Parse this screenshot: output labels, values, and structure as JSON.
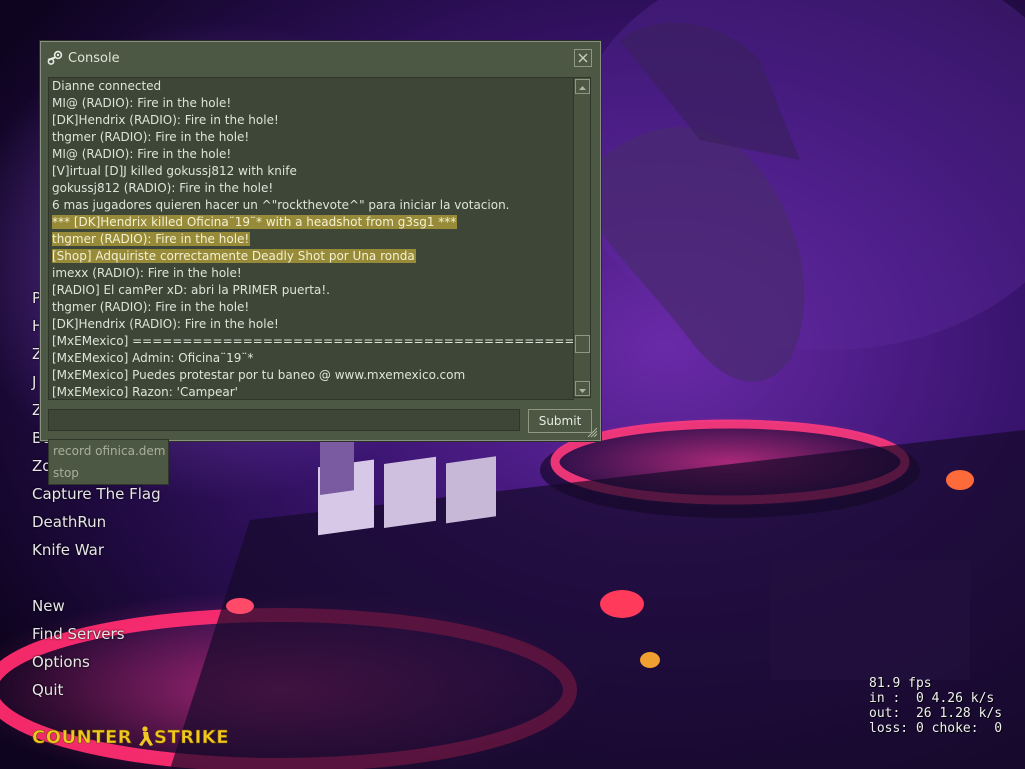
{
  "console": {
    "title": "Console",
    "lines": [
      {
        "text": "Dianne connected",
        "highlight": false
      },
      {
        "text": "MI@ (RADIO): Fire in the hole!",
        "highlight": false
      },
      {
        "text": "[DK]Hendrix (RADIO): Fire in the hole!",
        "highlight": false
      },
      {
        "text": "thgmer (RADIO): Fire in the hole!",
        "highlight": false
      },
      {
        "text": "MI@ (RADIO): Fire in the hole!",
        "highlight": false
      },
      {
        "text": "[V]irtual [D]J killed gokussj812 with knife",
        "highlight": false
      },
      {
        "text": "gokussj812 (RADIO): Fire in the hole!",
        "highlight": false
      },
      {
        "text": "6 mas jugadores quieren hacer un ^\"rockthevote^\" para iniciar la votacion.",
        "highlight": false
      },
      {
        "text": "*** [DK]Hendrix killed Oficina¨19¨* with a headshot from g3sg1 ***",
        "highlight": true
      },
      {
        "text": "thgmer (RADIO): Fire in the hole!",
        "highlight": true
      },
      {
        "text": "[Shop] Adquiriste correctamente Deadly Shot por Una ronda",
        "highlight": true
      },
      {
        "text": "imexx (RADIO): Fire in the hole!",
        "highlight": false
      },
      {
        "text": "[RADIO] El camPer xD: abri la PRIMER puerta!.",
        "highlight": false
      },
      {
        "text": "thgmer (RADIO): Fire in the hole!",
        "highlight": false
      },
      {
        "text": "[DK]Hendrix (RADIO): Fire in the hole!",
        "highlight": false
      },
      {
        "text": "[MxEMexico] ================================================",
        "highlight": false
      },
      {
        "text": "[MxEMexico] Admin: Oficina¨19¨*",
        "highlight": false
      },
      {
        "text": "[MxEMexico] Puedes protestar por tu baneo @ www.mxemexico.com",
        "highlight": false
      },
      {
        "text": "[MxEMexico] Razon: 'Campear'",
        "highlight": false
      }
    ],
    "input_value": "",
    "submit_label": "Submit",
    "suggestions": [
      "record ofinica.dem",
      "stop"
    ]
  },
  "menu": {
    "partial_items": [
      "P",
      "H",
      "Z",
      "J",
      "Z",
      "Bu",
      "Zo"
    ],
    "items": [
      "Capture The Flag",
      "DeathRun",
      "Knife War"
    ],
    "actions": [
      "New",
      "Find Servers",
      "Options",
      "Quit"
    ]
  },
  "logo": {
    "text": "COUNTER STRIKE",
    "color": "#f0c820"
  },
  "netgraph": {
    "fps": "81.9 fps",
    "in": "in :  0 4.26 k/s",
    "out": "out:  26 1.28 k/s",
    "loss": "loss: 0 choke:  0"
  },
  "colors": {
    "console_bg": "#4c5844",
    "console_text": "#dfe4d8",
    "highlight_bg": "#978b39",
    "menu_text": "#e6e6e6"
  }
}
